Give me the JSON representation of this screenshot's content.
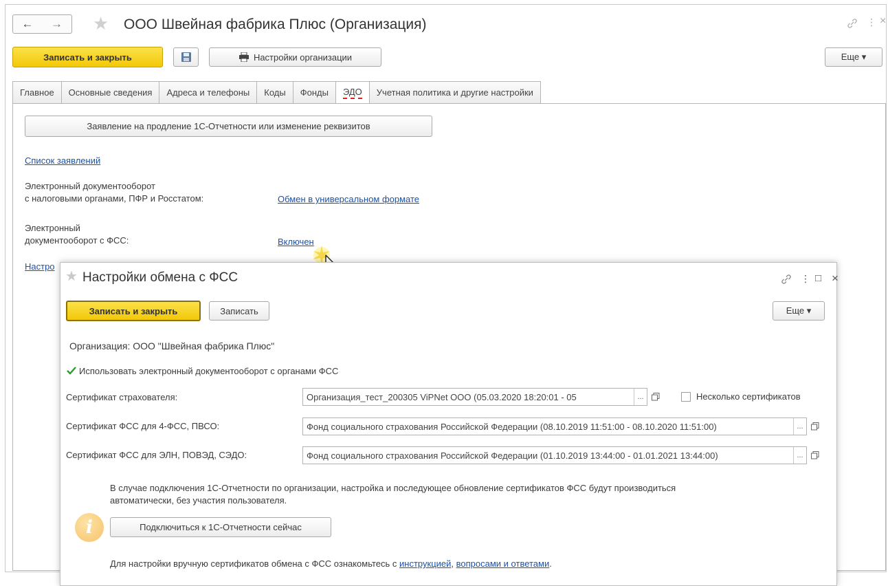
{
  "main": {
    "title": "ООО Швейная фабрика Плюс (Организация)",
    "nav_back": "←",
    "nav_forward": "→",
    "toolbar": {
      "save_close_label": "Записать и закрыть",
      "org_settings_label": "Настройки организации",
      "more_label": "Еще ▾"
    },
    "tabs": [
      {
        "label": "Главное"
      },
      {
        "label": "Основные сведения"
      },
      {
        "label": "Адреса и телефоны"
      },
      {
        "label": "Коды"
      },
      {
        "label": "Фонды"
      },
      {
        "label": "ЭДО"
      },
      {
        "label": "Учетная политика и другие настройки"
      }
    ],
    "active_tab": "ЭДО",
    "edo": {
      "renewal_button": "Заявление на продление 1С-Отчетности или изменение реквизитов",
      "applications_link": "Список заявлений",
      "tax_label_line1": "Электронный документооборот",
      "tax_label_line2": "с налоговыми органами, ПФР и Росстатом:",
      "tax_link": "Обмен в универсальном формате",
      "fss_label_line1": "Электронный",
      "fss_label_line2": "документооборот с ФСС:",
      "fss_link": "Включен",
      "settings_link_partial": "Настро"
    }
  },
  "dialog": {
    "title": "Настройки обмена с ФСС",
    "save_close_label": "Записать и закрыть",
    "save_label": "Записать",
    "more_label": "Еще ▾",
    "organization_label": "Организация: ООО \"Швейная фабрика Плюс\"",
    "use_edo_checkbox": {
      "label": "Использовать электронный документооборот с органами ФСС",
      "checked": true
    },
    "fields": {
      "insurer_cert": {
        "label": "Сертификат страхователя:",
        "value": "Организация_тест_200305 ViPNet ООО (05.03.2020 18:20:01 - 05"
      },
      "multi_cert": {
        "label": "Несколько сертификатов",
        "checked": false
      },
      "fss_cert_4fss": {
        "label": "Сертификат ФСС для 4-ФСС, ПВСО:",
        "value": "Фонд социального страхования Российской Федерации (08.10.2019 11:51:00 - 08.10.2020 11:51:00)"
      },
      "fss_cert_eln": {
        "label": "Сертификат ФСС для ЭЛН, ПОВЭД, СЭДО:",
        "value": "Фонд социального страхования Российской Федерации (01.10.2019 13:44:00 - 01.01.2021 13:44:00)"
      }
    },
    "info": {
      "text_line1": "В случае подключения 1С-Отчетности по организации, настройка и последующее обновление сертификатов ФСС будут производиться",
      "text_line2": "автоматически, без участия пользователя.",
      "connect_button": "Подключиться к 1С-Отчетности сейчас",
      "footer_prefix": "Для настройки вручную сертификатов обмена с ФСС ознакомьтесь с ",
      "footer_link1": "инструкцией",
      "footer_sep": ", ",
      "footer_link2": "вопросами и ответами",
      "footer_suffix": "."
    }
  },
  "icons": {
    "star": "★",
    "dots": "...",
    "more_vert": "⋮",
    "close": "×",
    "maximize": "□",
    "info": "i"
  },
  "colors": {
    "primary_button": "#f2c807",
    "link": "#1c52a6",
    "active_tab_underline": "#e32020",
    "info_icon": "#f6c36a"
  }
}
